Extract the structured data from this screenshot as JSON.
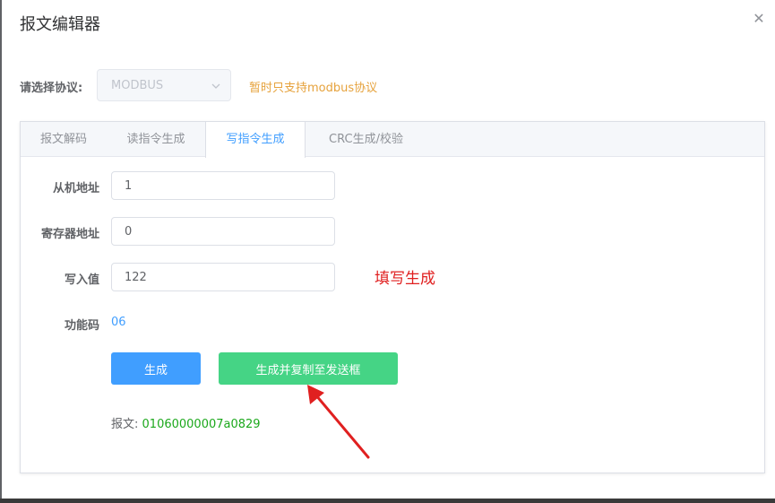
{
  "dialog": {
    "title": "报文编辑器",
    "close_icon": "close-icon"
  },
  "protocol": {
    "label": "请选择协议:",
    "value": "MODBUS",
    "hint": "暂时只支持modbus协议"
  },
  "tabs": [
    {
      "label": "报文解码",
      "active": false
    },
    {
      "label": "读指令生成",
      "active": false
    },
    {
      "label": "写指令生成",
      "active": true
    },
    {
      "label": "CRC生成/校验",
      "active": false
    }
  ],
  "form": {
    "slave_address": {
      "label": "从机地址",
      "value": "1"
    },
    "register_address": {
      "label": "寄存器地址",
      "value": "0"
    },
    "write_value": {
      "label": "写入值",
      "value": "122"
    },
    "function_code": {
      "label": "功能码",
      "value": "06"
    }
  },
  "annotation": "填写生成",
  "buttons": {
    "generate": "生成",
    "generate_and_copy": "生成并复制至发送框"
  },
  "message": {
    "label": "报文:",
    "value": "01060000007a0829"
  },
  "colors": {
    "primary": "#409eff",
    "success": "#45d485",
    "warning": "#e6a23c",
    "annotation_red": "#e02020",
    "hex_green": "#1ca81c"
  }
}
